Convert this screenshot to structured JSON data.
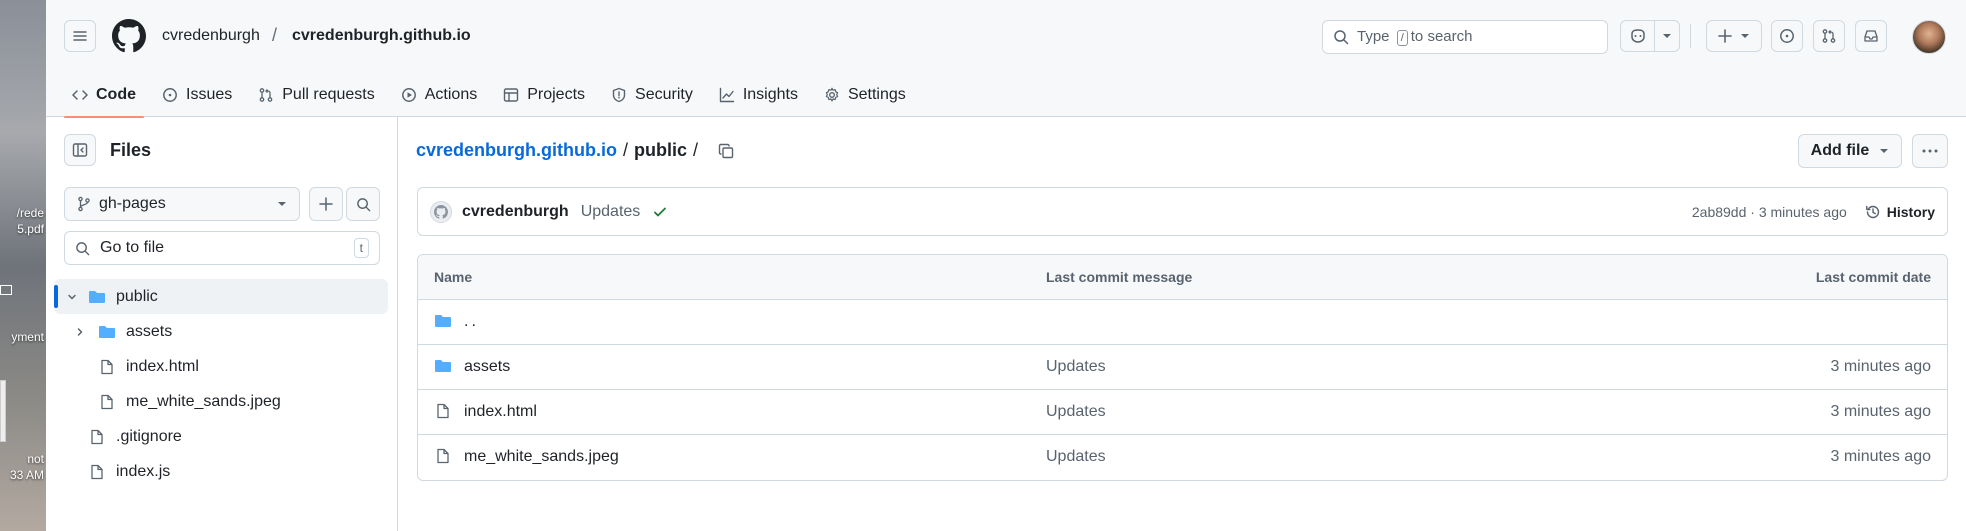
{
  "desktop": {
    "labels": [
      "/rede",
      "5.pdf",
      "yment",
      "not",
      "33 AM"
    ]
  },
  "header": {
    "owner": "cvredenburgh",
    "separator": "/",
    "repo": "cvredenburgh.github.io",
    "search": {
      "pre": "Type",
      "key": "/",
      "post": "to search"
    },
    "tabs": [
      {
        "label": "Code",
        "icon": "code-icon",
        "active": true
      },
      {
        "label": "Issues",
        "icon": "issue-icon"
      },
      {
        "label": "Pull requests",
        "icon": "pull-request-icon"
      },
      {
        "label": "Actions",
        "icon": "play-icon"
      },
      {
        "label": "Projects",
        "icon": "table-icon"
      },
      {
        "label": "Security",
        "icon": "shield-icon"
      },
      {
        "label": "Insights",
        "icon": "graph-icon"
      },
      {
        "label": "Settings",
        "icon": "gear-icon"
      }
    ]
  },
  "sidebar": {
    "title": "Files",
    "branch": "gh-pages",
    "goto_placeholder": "Go to file",
    "goto_shortcut": "t",
    "tree": [
      {
        "label": "public",
        "type": "folder",
        "expanded": true,
        "selected": true,
        "depth": 0
      },
      {
        "label": "assets",
        "type": "folder",
        "expanded": false,
        "depth": 1
      },
      {
        "label": "index.html",
        "type": "file",
        "depth": 1
      },
      {
        "label": "me_white_sands.jpeg",
        "type": "file",
        "depth": 1
      },
      {
        "label": ".gitignore",
        "type": "file",
        "depth": 0
      },
      {
        "label": "index.js",
        "type": "file",
        "depth": 0
      }
    ]
  },
  "main": {
    "path": {
      "repo": "cvredenburgh.github.io",
      "sep1": "/",
      "folder": "public",
      "sep2": "/"
    },
    "add_file": "Add file",
    "commit": {
      "author": "cvredenburgh",
      "message": "Updates",
      "hash_time": "2ab89dd · 3 minutes ago",
      "history": "History"
    },
    "table": {
      "headers": {
        "name": "Name",
        "message": "Last commit message",
        "date": "Last commit date"
      },
      "rows": [
        {
          "name": "..",
          "type": "folder",
          "message": "",
          "date": ""
        },
        {
          "name": "assets",
          "type": "folder",
          "message": "Updates",
          "date": "3 minutes ago"
        },
        {
          "name": "index.html",
          "type": "file",
          "message": "Updates",
          "date": "3 minutes ago"
        },
        {
          "name": "me_white_sands.jpeg",
          "type": "file",
          "message": "Updates",
          "date": "3 minutes ago"
        }
      ]
    }
  },
  "colors": {
    "link": "#0969da",
    "folder": "#54aeff",
    "success": "#1a7f37",
    "tab_underline": "#fd8c73"
  }
}
